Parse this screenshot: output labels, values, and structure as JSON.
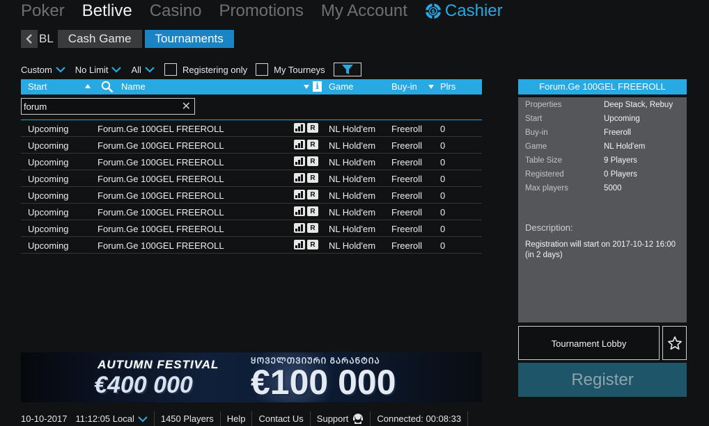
{
  "nav": {
    "poker": "Poker",
    "betlive": "Betlive",
    "casino": "Casino",
    "promotions": "Promotions",
    "my_account": "My Account",
    "cashier": "Cashier"
  },
  "subnav": {
    "prefix": "BL",
    "tabs": [
      "Cash Game",
      "Tournaments"
    ],
    "active_tab": "Tournaments"
  },
  "filters": {
    "type": "Custom",
    "limit": "No Limit",
    "game": "All",
    "registering_only": {
      "label": "Registering only",
      "checked": false
    },
    "my_tourneys": {
      "label": "My Tourneys",
      "checked": false
    }
  },
  "table": {
    "headers": {
      "start": "Start",
      "name": "Name",
      "info": "i",
      "game": "Game",
      "buyin": "Buy-in",
      "plrs": "Plrs"
    },
    "search_value": "forum",
    "badge_r": "R",
    "rows": [
      {
        "start": "Upcoming",
        "name": "Forum.Ge 100GEL FREEROLL",
        "game": "NL Hold'em",
        "buyin": "Freeroll",
        "plrs": "0"
      },
      {
        "start": "Upcoming",
        "name": "Forum.Ge 100GEL FREEROLL",
        "game": "NL Hold'em",
        "buyin": "Freeroll",
        "plrs": "0"
      },
      {
        "start": "Upcoming",
        "name": "Forum.Ge 100GEL FREEROLL",
        "game": "NL Hold'em",
        "buyin": "Freeroll",
        "plrs": "0"
      },
      {
        "start": "Upcoming",
        "name": "Forum.Ge 100GEL FREEROLL",
        "game": "NL Hold'em",
        "buyin": "Freeroll",
        "plrs": "0"
      },
      {
        "start": "Upcoming",
        "name": "Forum.Ge 100GEL FREEROLL",
        "game": "NL Hold'em",
        "buyin": "Freeroll",
        "plrs": "0"
      },
      {
        "start": "Upcoming",
        "name": "Forum.Ge 100GEL FREEROLL",
        "game": "NL Hold'em",
        "buyin": "Freeroll",
        "plrs": "0"
      },
      {
        "start": "Upcoming",
        "name": "Forum.Ge 100GEL FREEROLL",
        "game": "NL Hold'em",
        "buyin": "Freeroll",
        "plrs": "0"
      },
      {
        "start": "Upcoming",
        "name": "Forum.Ge 100GEL FREEROLL",
        "game": "NL Hold'em",
        "buyin": "Freeroll",
        "plrs": "0"
      }
    ]
  },
  "banner": {
    "title": "AUTUMN FESTIVAL",
    "amount_left": "€400 000",
    "subtitle": "ᲧᲝᲕᲔᲚᲗᲕᲘᲣᲠᲘ ᲒᲐᲠᲐᲜᲢᲘᲐ",
    "amount_right": "€100 000"
  },
  "status": {
    "date": "10-10-2017",
    "time": "11:12:05 Local",
    "players": "1450 Players",
    "help": "Help",
    "contact": "Contact Us",
    "support": "Support",
    "connected": "Connected: 00:08:33"
  },
  "detail": {
    "title": "Forum.Ge 100GEL FREEROLL",
    "properties": [
      {
        "key": "Properties",
        "value": "Deep Stack, Rebuy"
      },
      {
        "key": "Start",
        "value": "Upcoming"
      },
      {
        "key": "Buy-in",
        "value": "Freeroll"
      },
      {
        "key": "Game",
        "value": "NL Hold'em"
      },
      {
        "key": "Table Size",
        "value": "9 Players"
      },
      {
        "key": "Registered",
        "value": "0 Players"
      },
      {
        "key": "Max players",
        "value": "5000"
      }
    ],
    "description_label": "Description:",
    "description": "Registration will start on 2017-10-12 16:00 (in 2 days)",
    "lobby_button": "Tournament Lobby",
    "register_button": "Register"
  },
  "colors": {
    "accent": "#29a9e1",
    "active_tab": "#1a84c4",
    "panel": "#555659",
    "register": "#1e5569"
  }
}
